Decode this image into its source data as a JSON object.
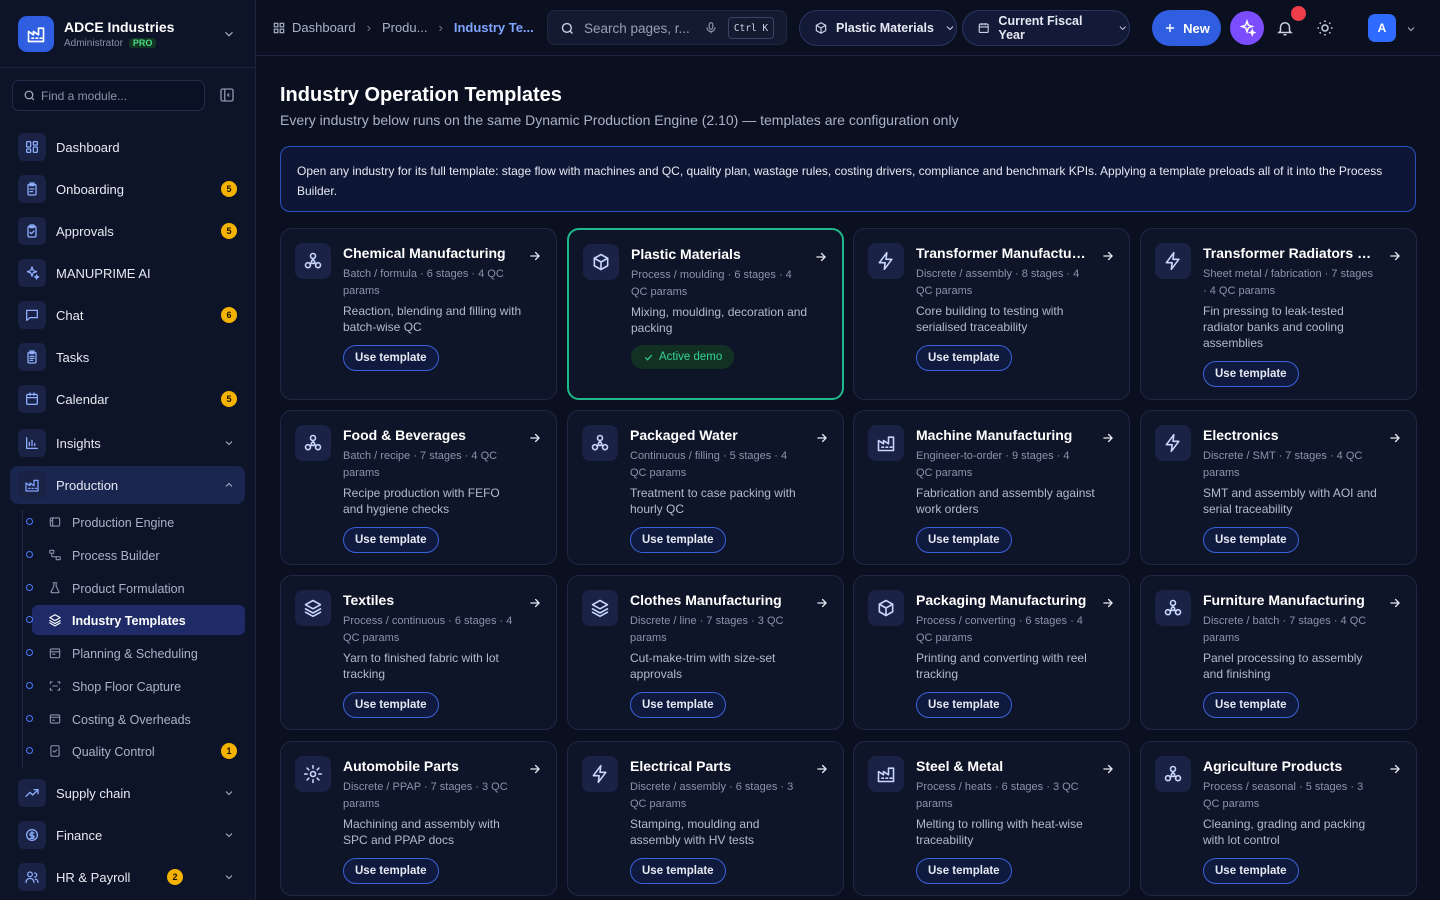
{
  "brand": {
    "name": "ADCE Industries",
    "role": "Administrator",
    "tier": "PRO"
  },
  "sidebar": {
    "find_placeholder": "Find a module...",
    "items": [
      {
        "label": "Dashboard",
        "icon": "dashboard-icon"
      },
      {
        "label": "Onboarding",
        "icon": "clipboard-icon",
        "badge": "5"
      },
      {
        "label": "Approvals",
        "icon": "clipboard-check-icon",
        "badge": "5"
      },
      {
        "label": "MANUPRIME AI",
        "icon": "sparkles-icon"
      },
      {
        "label": "Chat",
        "icon": "chat-icon",
        "badge": "6"
      },
      {
        "label": "Tasks",
        "icon": "tasks-icon"
      },
      {
        "label": "Calendar",
        "icon": "calendar-icon",
        "badge": "5"
      },
      {
        "label": "Insights",
        "icon": "chart-icon"
      },
      {
        "label": "Production",
        "icon": "factory-icon"
      },
      {
        "label": "Supply chain",
        "icon": "trend-icon"
      },
      {
        "label": "Finance",
        "icon": "finance-icon"
      },
      {
        "label": "HR & Payroll",
        "icon": "users-icon",
        "badge": "2"
      }
    ],
    "production_sub": [
      {
        "label": "Production Engine"
      },
      {
        "label": "Process Builder"
      },
      {
        "label": "Product Formulation"
      },
      {
        "label": "Industry Templates"
      },
      {
        "label": "Planning & Scheduling"
      },
      {
        "label": "Shop Floor Capture"
      },
      {
        "label": "Costing & Overheads"
      },
      {
        "label": "Quality Control",
        "badge": "1"
      }
    ]
  },
  "topbar": {
    "breadcrumb": [
      "Dashboard",
      "Produ...",
      "Industry Te..."
    ],
    "search_placeholder": "Search pages, r...",
    "shortcut": "Ctrl K",
    "industry_select": "Plastic Materials",
    "period_select": "Current Fiscal Year",
    "new_label": "New",
    "avatar_initial": "A"
  },
  "page": {
    "title": "Industry Operation Templates",
    "subtitle": "Every industry below runs on the same Dynamic Production Engine (2.10) — templates are configuration only",
    "info": "Open any industry for its full template: stage flow with machines and QC, quality plan, wastage rules, costing drivers, compliance and benchmark KPIs. Applying a template preloads all of it into the Process Builder."
  },
  "templates": [
    {
      "title": "Chemical Manufacturing",
      "meta": "Batch / formula · 6 stages · 4 QC params",
      "desc": "Reaction, blending and filling with batch-wise QC",
      "action": "Use template",
      "icon": "molecule-icon"
    },
    {
      "title": "Plastic Materials",
      "meta": "Process / moulding · 6 stages · 4 QC params",
      "desc": "Mixing, moulding, decoration and packing",
      "action": "Active demo",
      "icon": "cube-icon",
      "active": true
    },
    {
      "title": "Transformer Manufacturing",
      "meta": "Discrete / assembly · 8 stages · 4 QC params",
      "desc": "Core building to testing with serialised traceability",
      "action": "Use template",
      "icon": "bolt-icon"
    },
    {
      "title": "Transformer Radiators & Cooling",
      "meta": "Sheet metal / fabrication · 7 stages · 4 QC params",
      "desc": "Fin pressing to leak-tested radiator banks and cooling assemblies",
      "action": "Use template",
      "icon": "bolt-icon"
    },
    {
      "title": "Food & Beverages",
      "meta": "Batch / recipe · 7 stages · 4 QC params",
      "desc": "Recipe production with FEFO and hygiene checks",
      "action": "Use template",
      "icon": "molecule-icon"
    },
    {
      "title": "Packaged Water",
      "meta": "Continuous / filling · 5 stages · 4 QC params",
      "desc": "Treatment to case packing with hourly QC",
      "action": "Use template",
      "icon": "molecule-icon"
    },
    {
      "title": "Machine Manufacturing",
      "meta": "Engineer-to-order · 9 stages · 4 QC params",
      "desc": "Fabrication and assembly against work orders",
      "action": "Use template",
      "icon": "factory-icon"
    },
    {
      "title": "Electronics",
      "meta": "Discrete / SMT · 7 stages · 4 QC params",
      "desc": "SMT and assembly with AOI and serial traceability",
      "action": "Use template",
      "icon": "bolt-icon"
    },
    {
      "title": "Textiles",
      "meta": "Process / continuous · 6 stages · 4 QC params",
      "desc": "Yarn to finished fabric with lot tracking",
      "action": "Use template",
      "icon": "layers-icon"
    },
    {
      "title": "Clothes Manufacturing",
      "meta": "Discrete / line · 7 stages · 3 QC params",
      "desc": "Cut-make-trim with size-set approvals",
      "action": "Use template",
      "icon": "layers-icon"
    },
    {
      "title": "Packaging Manufacturing",
      "meta": "Process / converting · 6 stages · 4 QC params",
      "desc": "Printing and converting with reel tracking",
      "action": "Use template",
      "icon": "cube-icon"
    },
    {
      "title": "Furniture Manufacturing",
      "meta": "Discrete / batch · 7 stages · 4 QC params",
      "desc": "Panel processing to assembly and finishing",
      "action": "Use template",
      "icon": "molecule-icon"
    },
    {
      "title": "Automobile Parts",
      "meta": "Discrete / PPAP · 7 stages · 3 QC params",
      "desc": "Machining and assembly with SPC and PPAP docs",
      "action": "Use template",
      "icon": "gear-icon"
    },
    {
      "title": "Electrical Parts",
      "meta": "Discrete / assembly · 6 stages · 3 QC params",
      "desc": "Stamping, moulding and assembly with HV tests",
      "action": "Use template",
      "icon": "bolt-icon"
    },
    {
      "title": "Steel & Metal",
      "meta": "Process / heats · 6 stages · 3 QC params",
      "desc": "Melting to rolling with heat-wise traceability",
      "action": "Use template",
      "icon": "factory-icon"
    },
    {
      "title": "Agriculture Products",
      "meta": "Process / seasonal · 5 stages · 3 QC params",
      "desc": "Cleaning, grading and packing with lot control",
      "action": "Use template",
      "icon": "molecule-icon"
    }
  ]
}
